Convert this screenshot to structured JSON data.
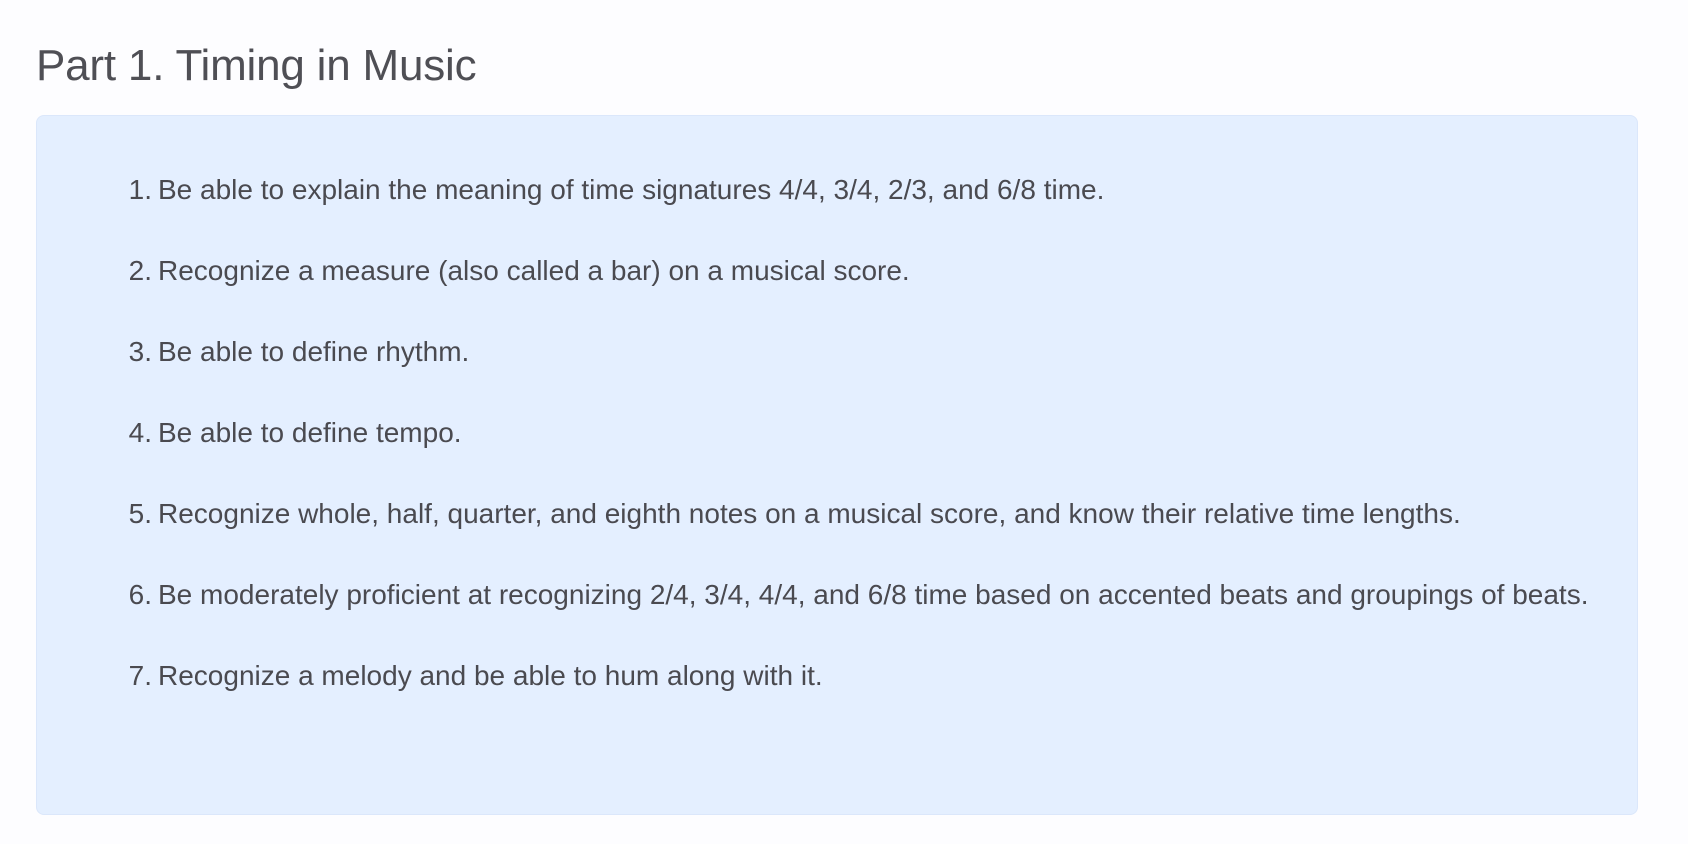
{
  "section": {
    "title": "Part 1. Timing in Music"
  },
  "objectives": [
    {
      "number": "1.",
      "text": "Be able to explain the meaning of time signatures 4/4, 3/4, 2/3, and 6/8 time."
    },
    {
      "number": "2.",
      "text": "Recognize a measure (also called a bar) on a musical score."
    },
    {
      "number": "3.",
      "text": "Be able to define rhythm."
    },
    {
      "number": "4.",
      "text": "Be able to define tempo."
    },
    {
      "number": "5.",
      "text": "Recognize whole, half, quarter, and eighth notes on a musical score, and know their relative time lengths."
    },
    {
      "number": "6.",
      "text": "Be moderately proficient at recognizing 2/4, 3/4, 4/4, and 6/8 time based on accented beats and groupings of beats."
    },
    {
      "number": "7.",
      "text": "Recognize a melody and be able to hum along with it."
    }
  ],
  "colors": {
    "panel_background": "#e4efff",
    "text": "#4a4a50",
    "page_background": "#fdfdff"
  }
}
